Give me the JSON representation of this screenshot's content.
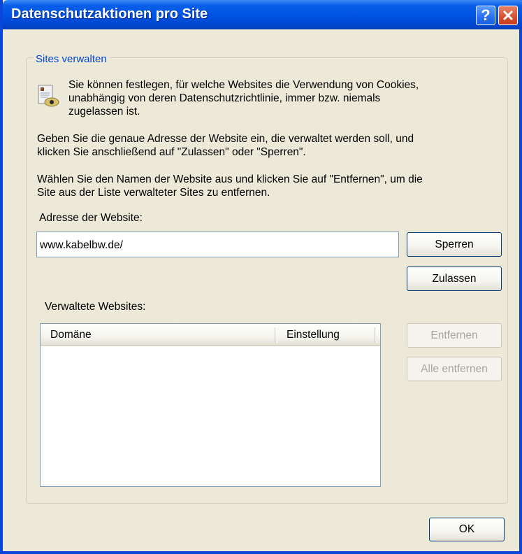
{
  "window": {
    "title": "Datenschutzaktionen pro Site",
    "help_glyph": "?",
    "close_glyph": "✕"
  },
  "group": {
    "legend": "Sites verwalten",
    "intro_line1": "Sie können festlegen, für welche Websites die Verwendung von Cookies,",
    "intro_line2": "unabhängig von deren Datenschutzrichtlinie, immer bzw. niemals",
    "intro_line3": "zugelassen ist.",
    "instr1_line1": "Geben Sie die genaue Adresse der Website ein, die verwaltet werden soll, und",
    "instr1_line2": "klicken Sie anschließend auf \"Zulassen\" oder \"Sperren\".",
    "instr2_line1": "Wählen Sie den Namen der Website aus und klicken Sie auf \"Entfernen\", um die",
    "instr2_line2": "Site aus der Liste verwalteter Sites zu entfernen.",
    "address_label": "Adresse der Website:",
    "address_value": "www.kabelbw.de/",
    "block_label": "Sperren",
    "allow_label": "Zulassen",
    "managed_label": "Verwaltete Websites:",
    "columns": [
      "Domäne",
      "Einstellung"
    ],
    "remove_label": "Entfernen",
    "remove_all_label": "Alle entfernen"
  },
  "ok_label": "OK",
  "icons": {
    "help": "help-icon",
    "close": "close-icon",
    "privacy": "privacy-cookie-icon"
  },
  "colors": {
    "titlebar": "#0054e3",
    "dialog_bg": "#ece9d8",
    "legend_text": "#0046d5"
  }
}
